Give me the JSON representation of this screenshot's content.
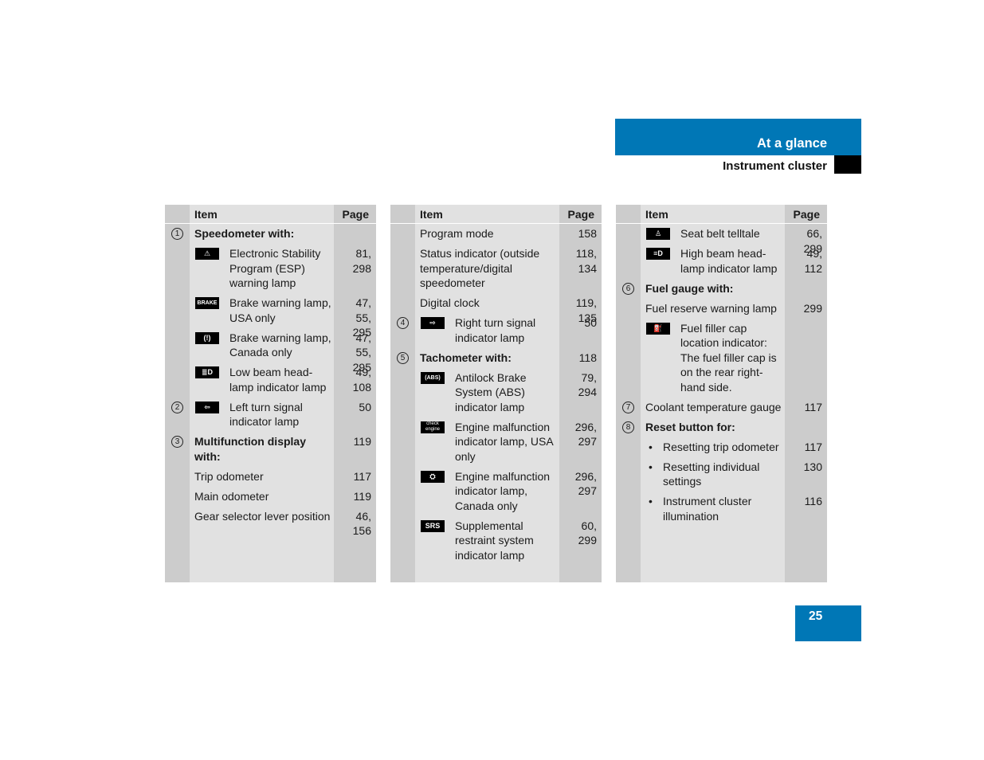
{
  "header": {
    "section": "At a glance",
    "subsection": "Instrument cluster"
  },
  "page_number": "25",
  "table_headers": {
    "item": "Item",
    "page": "Page"
  },
  "tables": [
    {
      "rows": [
        {
          "num": "1",
          "text": "Speedometer with:",
          "bold": true,
          "page": ""
        },
        {
          "icon": "esp-warning-icon",
          "glyph": "⚠",
          "text": "Electronic Stability Program (ESP) warning lamp",
          "page": "81,\n298"
        },
        {
          "icon": "brake-usa-icon",
          "glyph": "BRAKE",
          "text": "Brake warning lamp, USA only",
          "page": "47,\n55,\n295"
        },
        {
          "icon": "brake-canada-icon",
          "glyph": "(!)",
          "text": "Brake warning lamp, Canada only",
          "page": "47,\n55,\n295"
        },
        {
          "icon": "low-beam-icon",
          "glyph": "≣D",
          "text": "Low beam head-lamp indicator lamp",
          "page": "49,\n108"
        },
        {
          "num": "2",
          "icon": "left-turn-signal-icon",
          "glyph": "⇦",
          "text": "Left turn signal indicator lamp",
          "page": "50"
        },
        {
          "num": "3",
          "text": "Multifunction display with:",
          "bold": true,
          "page": "119"
        },
        {
          "text": "Trip odometer",
          "page": "117"
        },
        {
          "text": "Main odometer",
          "page": "119"
        },
        {
          "text": "Gear selector lever position",
          "page": "46,\n156"
        }
      ]
    },
    {
      "rows": [
        {
          "text": "Program mode",
          "page": "158"
        },
        {
          "text": "Status indicator (outside temperature/digital speedometer",
          "page": "118,\n134"
        },
        {
          "text": "Digital clock",
          "page": "119,\n135"
        },
        {
          "num": "4",
          "icon": "right-turn-signal-icon",
          "glyph": "⇨",
          "text": "Right turn signal indicator lamp",
          "page": "50"
        },
        {
          "num": "5",
          "text": "Tachometer with:",
          "bold": true,
          "page": "118"
        },
        {
          "icon": "abs-icon",
          "glyph": "(ABS)",
          "text": "Antilock Brake System (ABS) indicator lamp",
          "page": "79,\n294"
        },
        {
          "icon": "check-engine-icon",
          "glyph": "check engine",
          "text": "Engine malfunction indicator lamp, USA only",
          "page": "296,\n297"
        },
        {
          "icon": "engine-canada-icon",
          "glyph": "⛭",
          "text": "Engine malfunction indicator lamp, Canada only",
          "page": "296,\n297"
        },
        {
          "icon": "srs-icon",
          "glyph": "SRS",
          "text": "Supplemental restraint system indicator lamp",
          "page": "60,\n299"
        }
      ]
    },
    {
      "rows": [
        {
          "icon": "seat-belt-icon",
          "glyph": "♙",
          "text": "Seat belt telltale",
          "page": "66,\n299"
        },
        {
          "icon": "high-beam-icon",
          "glyph": "≡D",
          "text": "High beam head-lamp indicator lamp",
          "page": "49,\n112"
        },
        {
          "num": "6",
          "text": "Fuel gauge with:",
          "bold": true,
          "page": ""
        },
        {
          "text": "Fuel reserve warning lamp",
          "page": "299"
        },
        {
          "icon": "fuel-filler-icon",
          "glyph": "⛽",
          "text": "Fuel filler cap location indicator: The fuel filler cap is on the rear right-hand side.",
          "page": ""
        },
        {
          "num": "7",
          "text": "Coolant temperature gauge",
          "page": "117"
        },
        {
          "num": "8",
          "text": "Reset button for:",
          "bold": true,
          "page": ""
        },
        {
          "bullet": true,
          "text": "Resetting trip odometer",
          "page": "117"
        },
        {
          "bullet": true,
          "text": "Resetting individual settings",
          "page": "130"
        },
        {
          "bullet": true,
          "text": "Instrument cluster illumination",
          "page": "116"
        }
      ]
    }
  ]
}
